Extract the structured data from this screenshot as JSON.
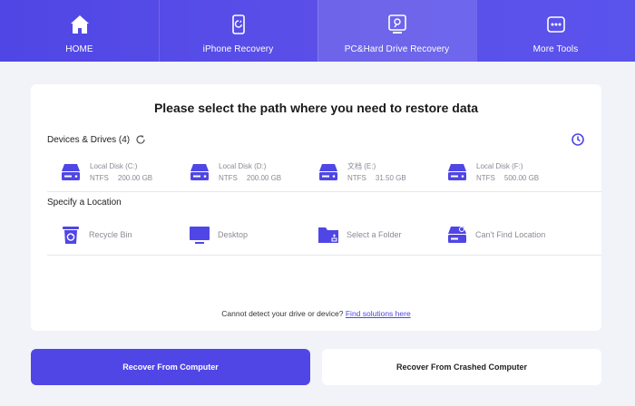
{
  "nav": {
    "tabs": [
      {
        "label": "HOME",
        "icon": "home-icon"
      },
      {
        "label": "iPhone Recovery",
        "icon": "iphone-icon"
      },
      {
        "label": "PC&Hard Drive Recovery",
        "icon": "pc-drive-icon"
      },
      {
        "label": "More Tools",
        "icon": "more-tools-icon"
      }
    ],
    "active_index": 2
  },
  "main": {
    "title": "Please select the path where you need to restore data",
    "devices_heading": "Devices & Drives (4)",
    "drives": [
      {
        "name": "Local Disk (C:)",
        "fs": "NTFS",
        "size": "200.00 GB"
      },
      {
        "name": "Local Disk (D:)",
        "fs": "NTFS",
        "size": "200.00 GB"
      },
      {
        "name": "文档 (E:)",
        "fs": "NTFS",
        "size": "31.50 GB"
      },
      {
        "name": "Local Disk (F:)",
        "fs": "NTFS",
        "size": "500.00 GB"
      }
    ],
    "location_heading": "Specify a Location",
    "locations": [
      {
        "label": "Recycle Bin",
        "icon": "recycle-bin-icon"
      },
      {
        "label": "Desktop",
        "icon": "desktop-icon"
      },
      {
        "label": "Select a Folder",
        "icon": "folder-icon"
      },
      {
        "label": "Can't Find Location",
        "icon": "drive-search-icon"
      }
    ],
    "hint_text": "Cannot detect your drive or device?",
    "hint_link": "Find solutions here"
  },
  "buttons": {
    "primary": "Recover From Computer",
    "secondary": "Recover From Crashed Computer"
  },
  "colors": {
    "accent": "#4f46e5",
    "background": "#f2f3f8",
    "panel": "#ffffff"
  }
}
